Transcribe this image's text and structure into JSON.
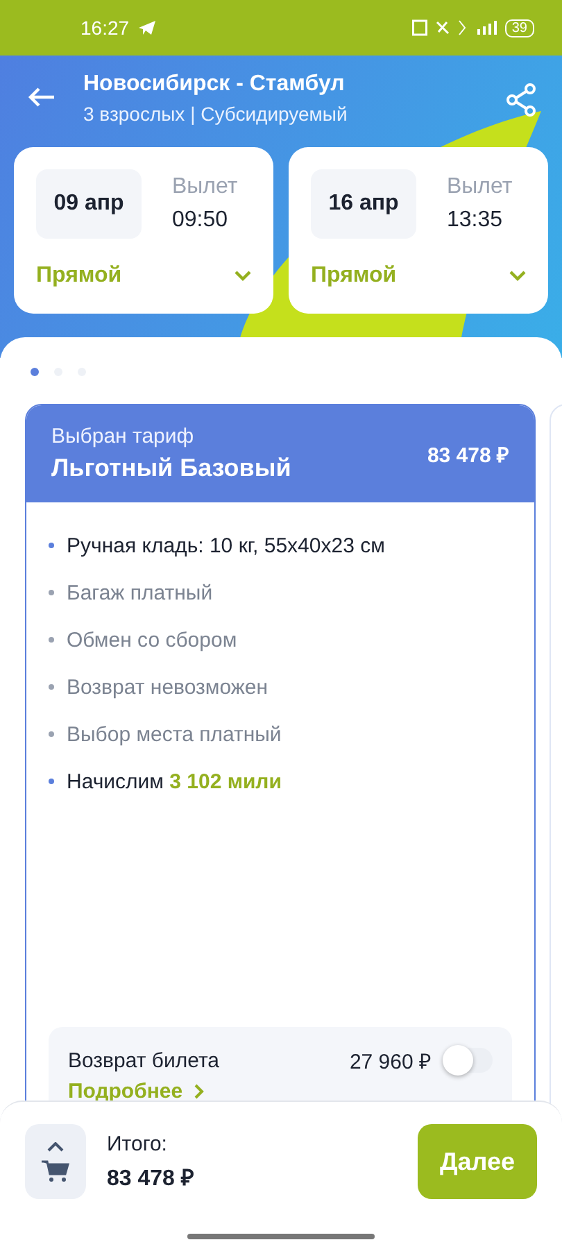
{
  "status_bar": {
    "time": "16:27",
    "battery": "39"
  },
  "header": {
    "title": "Новосибирск - Стамбул",
    "subtitle": "3 взрослых | Субсидируемый"
  },
  "flights": [
    {
      "date": "09 апр",
      "label": "Вылет",
      "time": "09:50",
      "type": "Прямой"
    },
    {
      "date": "16 апр",
      "label": "Вылет",
      "time": "13:35",
      "type": "Прямой"
    }
  ],
  "pager": [
    {
      "selected": true
    },
    {
      "selected": false
    },
    {
      "selected": false
    }
  ],
  "tariff": {
    "caption": "Выбран тариф",
    "name": "Льготный Базовый",
    "price": "83 478 ₽",
    "features": [
      {
        "text": "Ручная кладь: 10 кг, 55x40x23 см",
        "included": true
      },
      {
        "text": "Багаж платный",
        "included": false
      },
      {
        "text": "Обмен со сбором",
        "included": false
      },
      {
        "text": "Возврат невозможен",
        "included": false
      },
      {
        "text": "Выбор места платный",
        "included": false
      },
      {
        "text": "Начислим **3 102 мили**",
        "included": true
      }
    ],
    "option": {
      "label": "Возврат билета",
      "price": "27 960 ₽",
      "on": false,
      "link": "Подробнее"
    }
  },
  "footer": {
    "label": "Итого:",
    "total": "83 478 ₽",
    "button": "Далее"
  }
}
